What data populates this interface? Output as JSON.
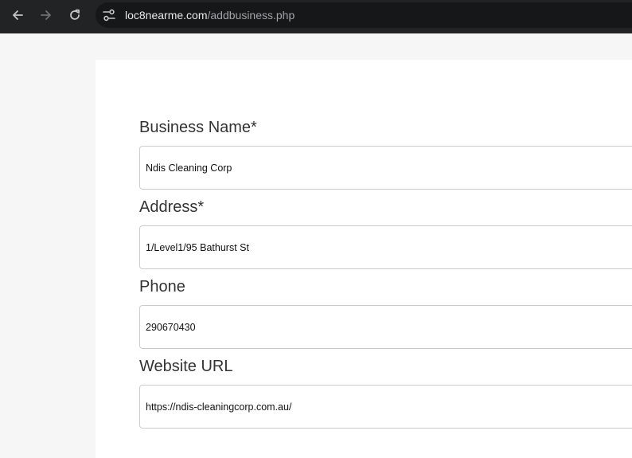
{
  "browser": {
    "url_host": "loc8nearme.com",
    "url_path": "/addbusiness.php"
  },
  "icons": {
    "back": "arrow-left-icon",
    "forward": "arrow-right-icon",
    "reload": "reload-icon",
    "site_info": "tune-icon"
  },
  "colors": {
    "toolbar": "#222324",
    "omnibox": "#161718",
    "page_bg": "#f6f6f6",
    "label": "#333333",
    "input_border": "#cccccc"
  },
  "form": {
    "fields": [
      {
        "label": "Business Name*",
        "value": "Ndis Cleaning Corp"
      },
      {
        "label": "Address*",
        "value": "1/Level1/95 Bathurst St"
      },
      {
        "label": "Phone",
        "value": "290670430"
      },
      {
        "label": "Website URL",
        "value": "https://ndis-cleaningcorp.com.au/"
      }
    ]
  }
}
